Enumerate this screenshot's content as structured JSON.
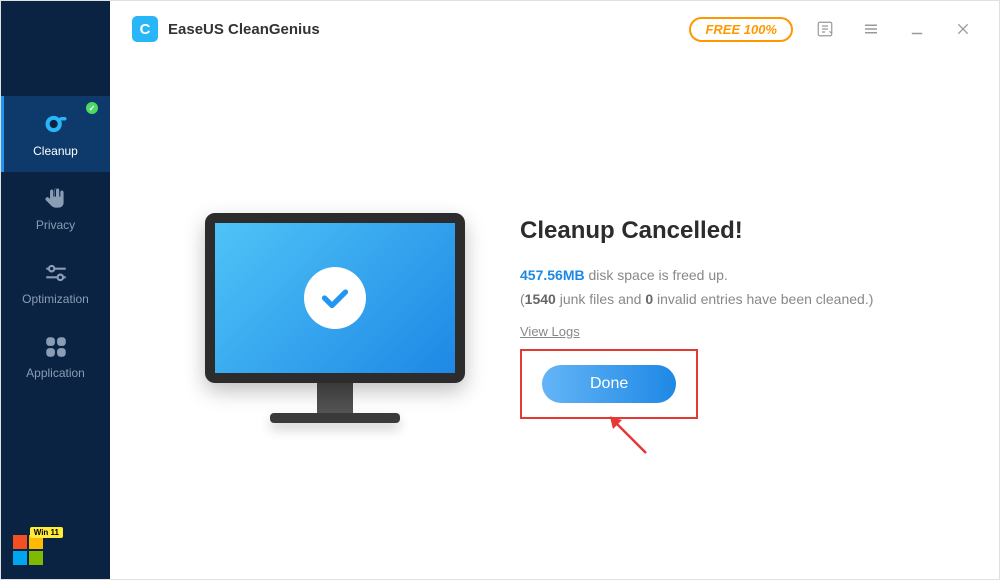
{
  "app": {
    "title": "EaseUS CleanGenius",
    "free_badge": "FREE 100%"
  },
  "sidebar": {
    "items": [
      {
        "label": "Cleanup",
        "active": true
      },
      {
        "label": "Privacy",
        "active": false
      },
      {
        "label": "Optimization",
        "active": false
      },
      {
        "label": "Application",
        "active": false
      }
    ],
    "win_badge": "Win 11"
  },
  "result": {
    "title": "Cleanup Cancelled!",
    "freed_size": "457.56MB",
    "freed_suffix": " disk space is freed up.",
    "stats_prefix": "(",
    "junk_count": "1540",
    "junk_label": " junk files and ",
    "invalid_count": "0",
    "invalid_label": " invalid entries have been cleaned.)",
    "view_logs": "View Logs",
    "done_button": "Done"
  }
}
